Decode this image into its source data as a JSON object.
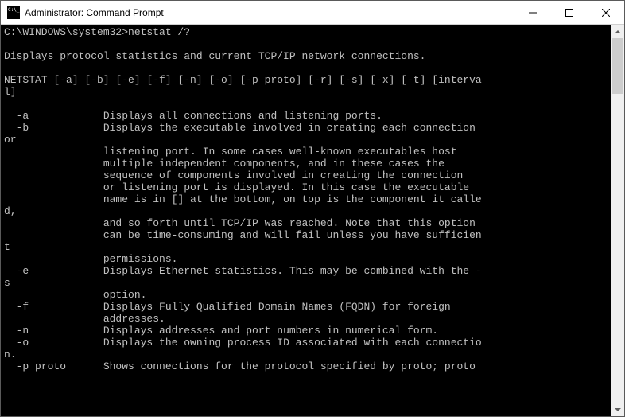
{
  "window": {
    "title": "Administrator: Command Prompt",
    "icon_name": "cmd-icon"
  },
  "terminal": {
    "prompt_path": "C:\\WINDOWS\\system32>",
    "command": "netstat /?",
    "output_lines": [
      "",
      "Displays protocol statistics and current TCP/IP network connections.",
      "",
      "NETSTAT [-a] [-b] [-e] [-f] [-n] [-o] [-p proto] [-r] [-s] [-x] [-t] [interval]",
      "",
      "  -a            Displays all connections and listening ports.",
      "  -b            Displays the executable involved in creating each connection or",
      "                listening port. In some cases well-known executables host",
      "                multiple independent components, and in these cases the",
      "                sequence of components involved in creating the connection",
      "                or listening port is displayed. In this case the executable",
      "                name is in [] at the bottom, on top is the component it called,",
      "                and so forth until TCP/IP was reached. Note that this option",
      "                can be time-consuming and will fail unless you have sufficient",
      "                permissions.",
      "  -e            Displays Ethernet statistics. This may be combined with the -s",
      "                option.",
      "  -f            Displays Fully Qualified Domain Names (FQDN) for foreign",
      "                addresses.",
      "  -n            Displays addresses and port numbers in numerical form.",
      "  -o            Displays the owning process ID associated with each connection.",
      "  -p proto      Shows connections for the protocol specified by proto; proto"
    ]
  }
}
